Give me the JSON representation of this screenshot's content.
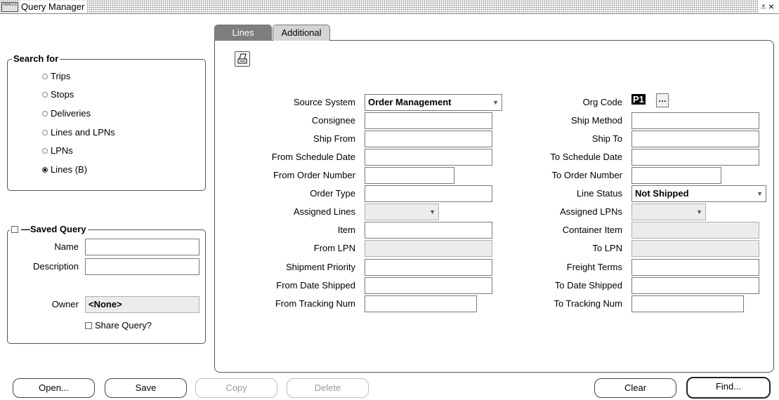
{
  "window": {
    "title": "Query Manager",
    "icon_text": "ORACLE",
    "controls": "⨡×"
  },
  "search_for": {
    "label": "Search for",
    "options": [
      {
        "label": "Trips",
        "selected": false
      },
      {
        "label": "Stops",
        "selected": false
      },
      {
        "label": "Deliveries",
        "selected": false
      },
      {
        "label": "Lines and LPNs",
        "selected": false
      },
      {
        "label": "LPNs",
        "selected": false
      },
      {
        "label": "Lines (B)",
        "selected": true
      }
    ]
  },
  "saved_query": {
    "label": "Saved Query",
    "checked": false,
    "name_label": "Name",
    "name_value": "",
    "description_label": "Description",
    "description_value": "",
    "owner_label": "Owner",
    "owner_value": "<None>",
    "share_label": "Share Query?",
    "share_checked": false
  },
  "tabs": [
    {
      "label": "Lines",
      "active": true
    },
    {
      "label": "Additional",
      "active": false
    }
  ],
  "left_fields": [
    {
      "label": "Source System",
      "value": "Order Management",
      "type": "select"
    },
    {
      "label": "Consignee",
      "value": "",
      "type": "text"
    },
    {
      "label": "Ship From",
      "value": "",
      "type": "text"
    },
    {
      "label": "From Schedule Date",
      "value": "",
      "type": "text"
    },
    {
      "label": "From Order Number",
      "value": "",
      "type": "text"
    },
    {
      "label": "Order Type",
      "value": "",
      "type": "text"
    },
    {
      "label": "Assigned Lines",
      "value": "",
      "type": "select-disabled"
    },
    {
      "label": "Item",
      "value": "",
      "type": "text"
    },
    {
      "label": "From LPN",
      "value": "",
      "type": "disabled"
    },
    {
      "label": "Shipment Priority",
      "value": "",
      "type": "text"
    },
    {
      "label": "From Date Shipped",
      "value": "",
      "type": "text"
    },
    {
      "label": "From Tracking Num",
      "value": "",
      "type": "text"
    }
  ],
  "right_fields": [
    {
      "label": "Org Code",
      "value": "P1",
      "type": "lov"
    },
    {
      "label": "Ship Method",
      "value": "",
      "type": "text"
    },
    {
      "label": "Ship To",
      "value": "",
      "type": "text"
    },
    {
      "label": "To Schedule Date",
      "value": "",
      "type": "text"
    },
    {
      "label": "To Order Number",
      "value": "",
      "type": "text"
    },
    {
      "label": "Line Status",
      "value": "Not Shipped",
      "type": "select"
    },
    {
      "label": "Assigned LPNs",
      "value": "",
      "type": "select-disabled"
    },
    {
      "label": "Container Item",
      "value": "",
      "type": "disabled"
    },
    {
      "label": "To LPN",
      "value": "",
      "type": "disabled"
    },
    {
      "label": "Freight Terms",
      "value": "",
      "type": "text"
    },
    {
      "label": "To Date Shipped",
      "value": "",
      "type": "text"
    },
    {
      "label": "To Tracking Num",
      "value": "",
      "type": "text"
    }
  ],
  "buttons": {
    "open": "Open...",
    "save": "Save",
    "copy": "Copy",
    "delete": "Delete",
    "clear": "Clear",
    "find": "Find..."
  },
  "icons": {
    "printer": "printer-icon",
    "lov": "…",
    "dropdown": "▼"
  }
}
